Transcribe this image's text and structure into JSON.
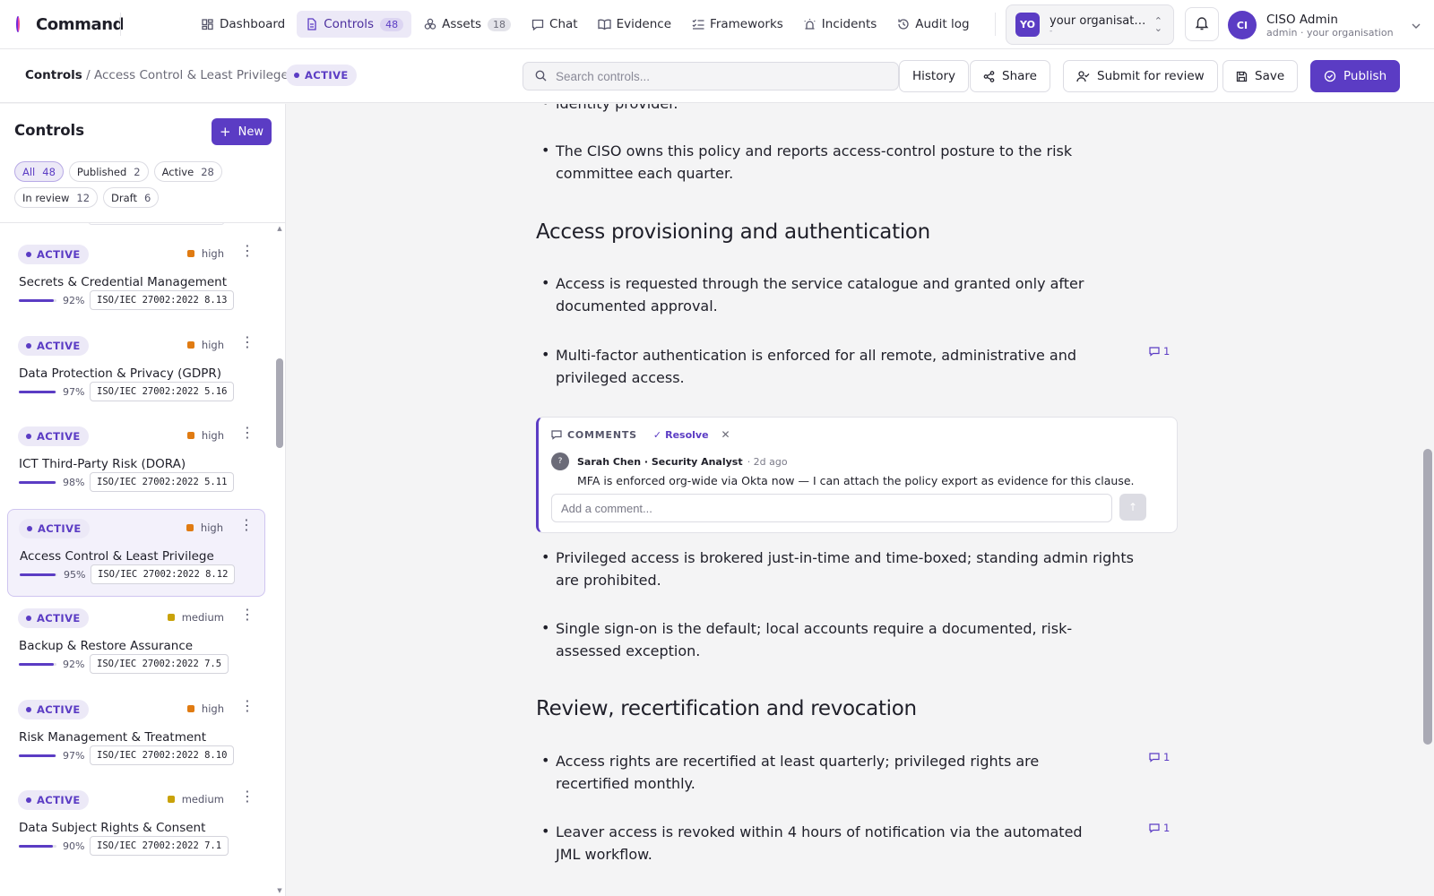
{
  "app": {
    "name": "Command"
  },
  "nav": [
    {
      "label": "Dashboard",
      "icon": "dashboard-icon",
      "count": null,
      "active": false
    },
    {
      "label": "Controls",
      "icon": "document-icon",
      "count": "48",
      "active": true
    },
    {
      "label": "Assets",
      "icon": "assets-icon",
      "count": "18",
      "active": false
    },
    {
      "label": "Chat",
      "icon": "chat-icon",
      "count": null,
      "active": false
    },
    {
      "label": "Evidence",
      "icon": "book-icon",
      "count": null,
      "active": false
    },
    {
      "label": "Frameworks",
      "icon": "list-check-icon",
      "count": null,
      "active": false
    },
    {
      "label": "Incidents",
      "icon": "alarm-icon",
      "count": null,
      "active": false
    },
    {
      "label": "Audit log",
      "icon": "history-icon",
      "count": null,
      "active": false
    }
  ],
  "org": {
    "badge": "YO",
    "name": "your organisation",
    "sub": "-"
  },
  "user": {
    "initials": "CI",
    "name": "CISO Admin",
    "sub": "admin · your organisation"
  },
  "subheader": {
    "breadcrumb_root": "Controls",
    "breadcrumb_sep": " / ",
    "breadcrumb_current": "Access Control & Least Privilege",
    "status": "ACTIVE",
    "search_placeholder": "Search controls...",
    "history_label": "History",
    "share_label": "Share",
    "submit_label": "Submit for review",
    "save_label": "Save",
    "publish_label": "Publish"
  },
  "sidebar": {
    "title": "Controls",
    "new_label": "New",
    "filters": [
      {
        "label": "All",
        "count": "48",
        "active": true
      },
      {
        "label": "Published",
        "count": "2",
        "active": false
      },
      {
        "label": "Active",
        "count": "28",
        "active": false
      },
      {
        "label": "In review",
        "count": "12",
        "active": false
      },
      {
        "label": "Draft",
        "count": "6",
        "active": false
      }
    ],
    "items": [
      {
        "status": "ACTIVE",
        "severity": "high",
        "title": "Secrets & Credential Management",
        "progress": 92,
        "progress_label": "92%",
        "ref": "ISO/IEC 27002:2022 8.13",
        "selected": false
      },
      {
        "status": "ACTIVE",
        "severity": "high",
        "title": "Data Protection & Privacy (GDPR)",
        "progress": 97,
        "progress_label": "97%",
        "ref": "ISO/IEC 27002:2022 5.16",
        "selected": false
      },
      {
        "status": "ACTIVE",
        "severity": "high",
        "title": "ICT Third-Party Risk (DORA)",
        "progress": 98,
        "progress_label": "98%",
        "ref": "ISO/IEC 27002:2022 5.11",
        "selected": false
      },
      {
        "status": "ACTIVE",
        "severity": "high",
        "title": "Access Control & Least Privilege",
        "progress": 95,
        "progress_label": "95%",
        "ref": "ISO/IEC 27002:2022 8.12",
        "selected": true
      },
      {
        "status": "ACTIVE",
        "severity": "medium",
        "title": "Backup & Restore Assurance",
        "progress": 92,
        "progress_label": "92%",
        "ref": "ISO/IEC 27002:2022 7.5",
        "selected": false
      },
      {
        "status": "ACTIVE",
        "severity": "high",
        "title": "Risk Management & Treatment",
        "progress": 97,
        "progress_label": "97%",
        "ref": "ISO/IEC 27002:2022 8.10",
        "selected": false
      },
      {
        "status": "ACTIVE",
        "severity": "medium",
        "title": "Data Subject Rights & Consent",
        "progress": 90,
        "progress_label": "90%",
        "ref": "ISO/IEC 27002:2022 7.1",
        "selected": false
      }
    ]
  },
  "document": {
    "partial_line": "identity provider.",
    "bullets_intro": [
      "The CISO owns this policy and reports access-control posture to the risk committee each quarter."
    ],
    "section1": {
      "heading": "Access provisioning and authentication",
      "bullets": [
        {
          "text": "Access is requested through the service catalogue and granted only after documented approval.",
          "comments": null
        },
        {
          "text": "Multi-factor authentication is enforced for all remote, administrative and privileged access.",
          "comments": "1"
        },
        {
          "text": "Privileged access is brokered just-in-time and time-boxed; standing admin rights are prohibited.",
          "comments": null
        },
        {
          "text": "Single sign-on is the default; local accounts require a documented, risk-assessed exception.",
          "comments": null
        }
      ]
    },
    "comment_panel": {
      "header": "COMMENTS",
      "resolve_label": "Resolve",
      "avatar": "?",
      "author": "Sarah Chen · Security Analyst",
      "time": "· 2d ago",
      "text": "MFA is enforced org-wide via Okta now — I can attach the policy export as evidence for this clause.",
      "input_placeholder": "Add a comment..."
    },
    "section2": {
      "heading": "Review, recertification and revocation",
      "bullets": [
        {
          "text": "Access rights are recertified at least quarterly; privileged rights are recertified monthly.",
          "comments": "1"
        },
        {
          "text": "Leaver access is revoked within 4 hours of notification via the automated JML workflow.",
          "comments": "1"
        }
      ]
    }
  },
  "colors": {
    "accent": "#5b3cc4",
    "accent_soft": "#ece9f7",
    "sev_high": "#e07b12",
    "sev_medium": "#c9a209"
  }
}
